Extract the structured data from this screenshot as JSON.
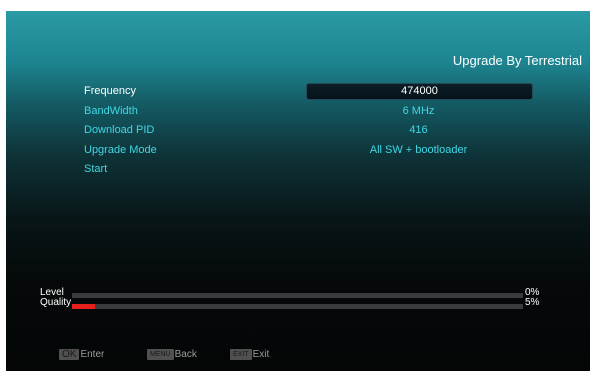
{
  "header": {
    "title": "Upgrade By Terrestrial"
  },
  "menu": {
    "items": [
      {
        "label": "Frequency",
        "value": "474000"
      },
      {
        "label": "BandWidth",
        "value": "6 MHz"
      },
      {
        "label": "Download PID",
        "value": "416"
      },
      {
        "label": "Upgrade Mode",
        "value": "All SW + bootloader"
      },
      {
        "label": "Start",
        "value": ""
      }
    ]
  },
  "signal": {
    "level": {
      "label": "Level",
      "value_text": "0%",
      "fraction": 0.0
    },
    "quality": {
      "label": "Quality",
      "value_text": "5%",
      "fraction": 0.05
    }
  },
  "help": {
    "ok": {
      "key": "OK",
      "label": "Enter"
    },
    "menu": {
      "key": "MENU",
      "label": "Back"
    },
    "exit": {
      "key": "EXIT",
      "label": "Exit"
    }
  },
  "colors": {
    "accent_text": "#3fd7e4",
    "selected_text": "#ffffff",
    "bar_fill": "#e8201c",
    "bar_track": "#3a3b3c"
  }
}
